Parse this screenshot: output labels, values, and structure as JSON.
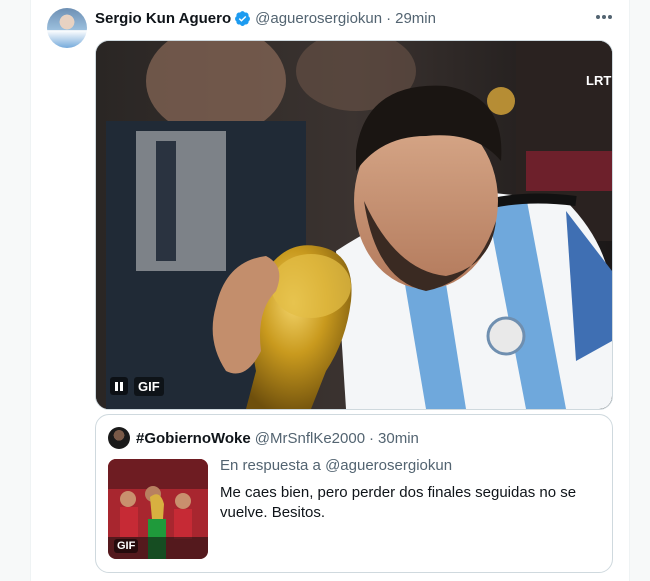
{
  "tweet": {
    "author_name": "Sergio Kun Aguero",
    "author_handle": "@aguerosergiokun",
    "separator": "·",
    "time": "29min",
    "verified": true,
    "media": {
      "type": "gif",
      "gif_label": "GIF",
      "overlay_watermark": "LRT"
    }
  },
  "quoted_tweet": {
    "author_name": "#GobiernoWoke",
    "author_handle": "@MrSnflKe2000",
    "separator": "·",
    "time": "30min",
    "reply_prefix": "En respuesta a",
    "reply_to_handle": "@aguerosergiokun",
    "text": "Me caes bien, pero perder dos finales seguidas no se vuelve. Besitos.",
    "thumbnail_label": "GIF"
  },
  "colors": {
    "verified_blue": "#1d9bf0",
    "secondary_text": "#536471",
    "border": "#cfd9de"
  },
  "icons": {
    "verified": "verified-badge-icon",
    "more": "more-dots-icon",
    "pause": "pause-icon"
  }
}
